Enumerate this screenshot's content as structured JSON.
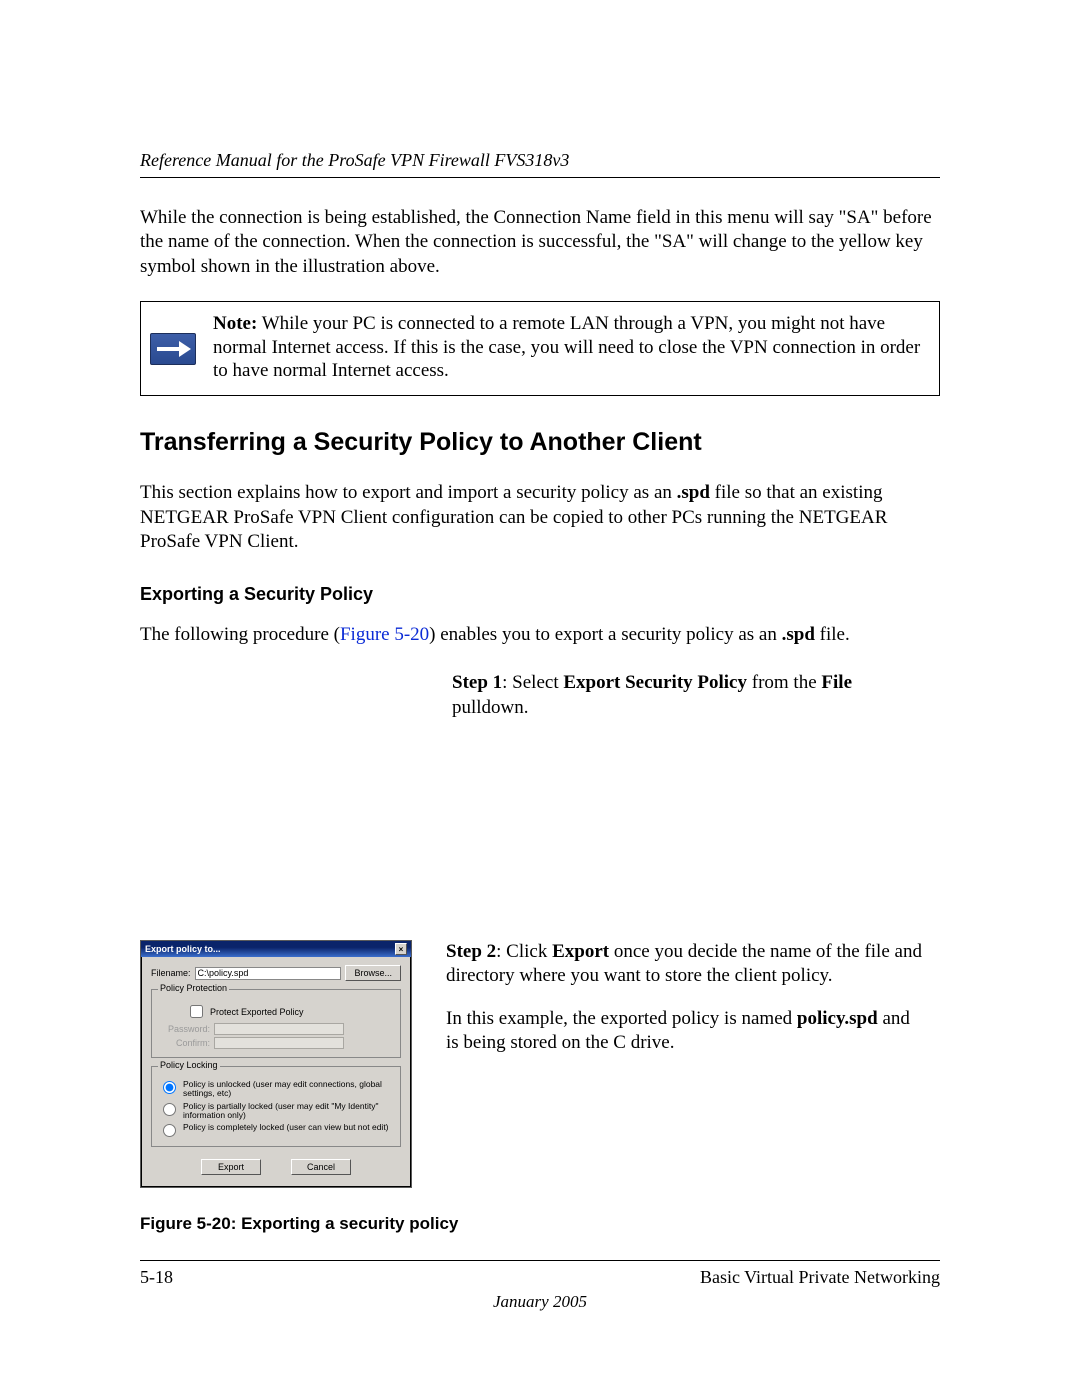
{
  "header": {
    "running_title": "Reference Manual for the ProSafe VPN Firewall FVS318v3"
  },
  "intro_paragraph": "While the connection is being established, the Connection Name field in this menu will say \"SA\" before the name of the connection. When the connection is successful, the \"SA\" will change to the yellow key symbol shown in the illustration above.",
  "note": {
    "label": "Note:",
    "text": " While your PC is connected to a remote LAN through a VPN, you might not have normal Internet access. If this is the case, you will need to close the VPN connection in order to have normal Internet access."
  },
  "section": {
    "heading": "Transferring a Security Policy to Another Client",
    "para_before_spd": "This section explains how to export and import a security policy as an ",
    "spd_bold": ".spd",
    "para_after_spd": " file so that an existing NETGEAR ProSafe VPN Client configuration can be copied to other PCs running the NETGEAR ProSafe VPN Client."
  },
  "exporting": {
    "subheading": "Exporting a Security Policy",
    "pre_figref": "The following procedure (",
    "figref": "Figure 5-20",
    "post_figref_a": ") enables you to export a security policy as an ",
    "spd_bold": ".spd",
    "post_figref_b": " file."
  },
  "step1": {
    "label": "Step 1",
    "after_label": ": Select ",
    "action": "Export Security Policy",
    "mid": " from the ",
    "menu": "File",
    "tail": " pulldown."
  },
  "step2": {
    "label": "Step 2",
    "after_label": ": Click ",
    "action": "Export",
    "tail": " once you decide the name of the file and directory where you want to store the client policy.",
    "example_pre": "In this example, the exported policy is named ",
    "example_bold": "policy.spd",
    "example_post": " and is being stored on the C drive."
  },
  "dialog": {
    "title": "Export policy to...",
    "close_glyph": "×",
    "filename_label": "Filename:",
    "filename_value": "C:\\policy.spd",
    "browse_label": "Browse...",
    "group_protection": "Policy Protection",
    "protect_checkbox": "Protect Exported Policy",
    "password_label": "Password:",
    "confirm_label": "Confirm:",
    "group_locking": "Policy Locking",
    "radio_unlocked": "Policy is unlocked (user may edit connections, global settings, etc)",
    "radio_partial": "Policy is partially locked (user may edit \"My Identity\" information only)",
    "radio_complete": "Policy is completely locked (user can view but not edit)",
    "export_btn": "Export",
    "cancel_btn": "Cancel"
  },
  "figure_caption": "Figure 5-20:  Exporting a security policy",
  "footer": {
    "page_num": "5-18",
    "chapter": "Basic Virtual Private Networking",
    "date": "January 2005"
  }
}
